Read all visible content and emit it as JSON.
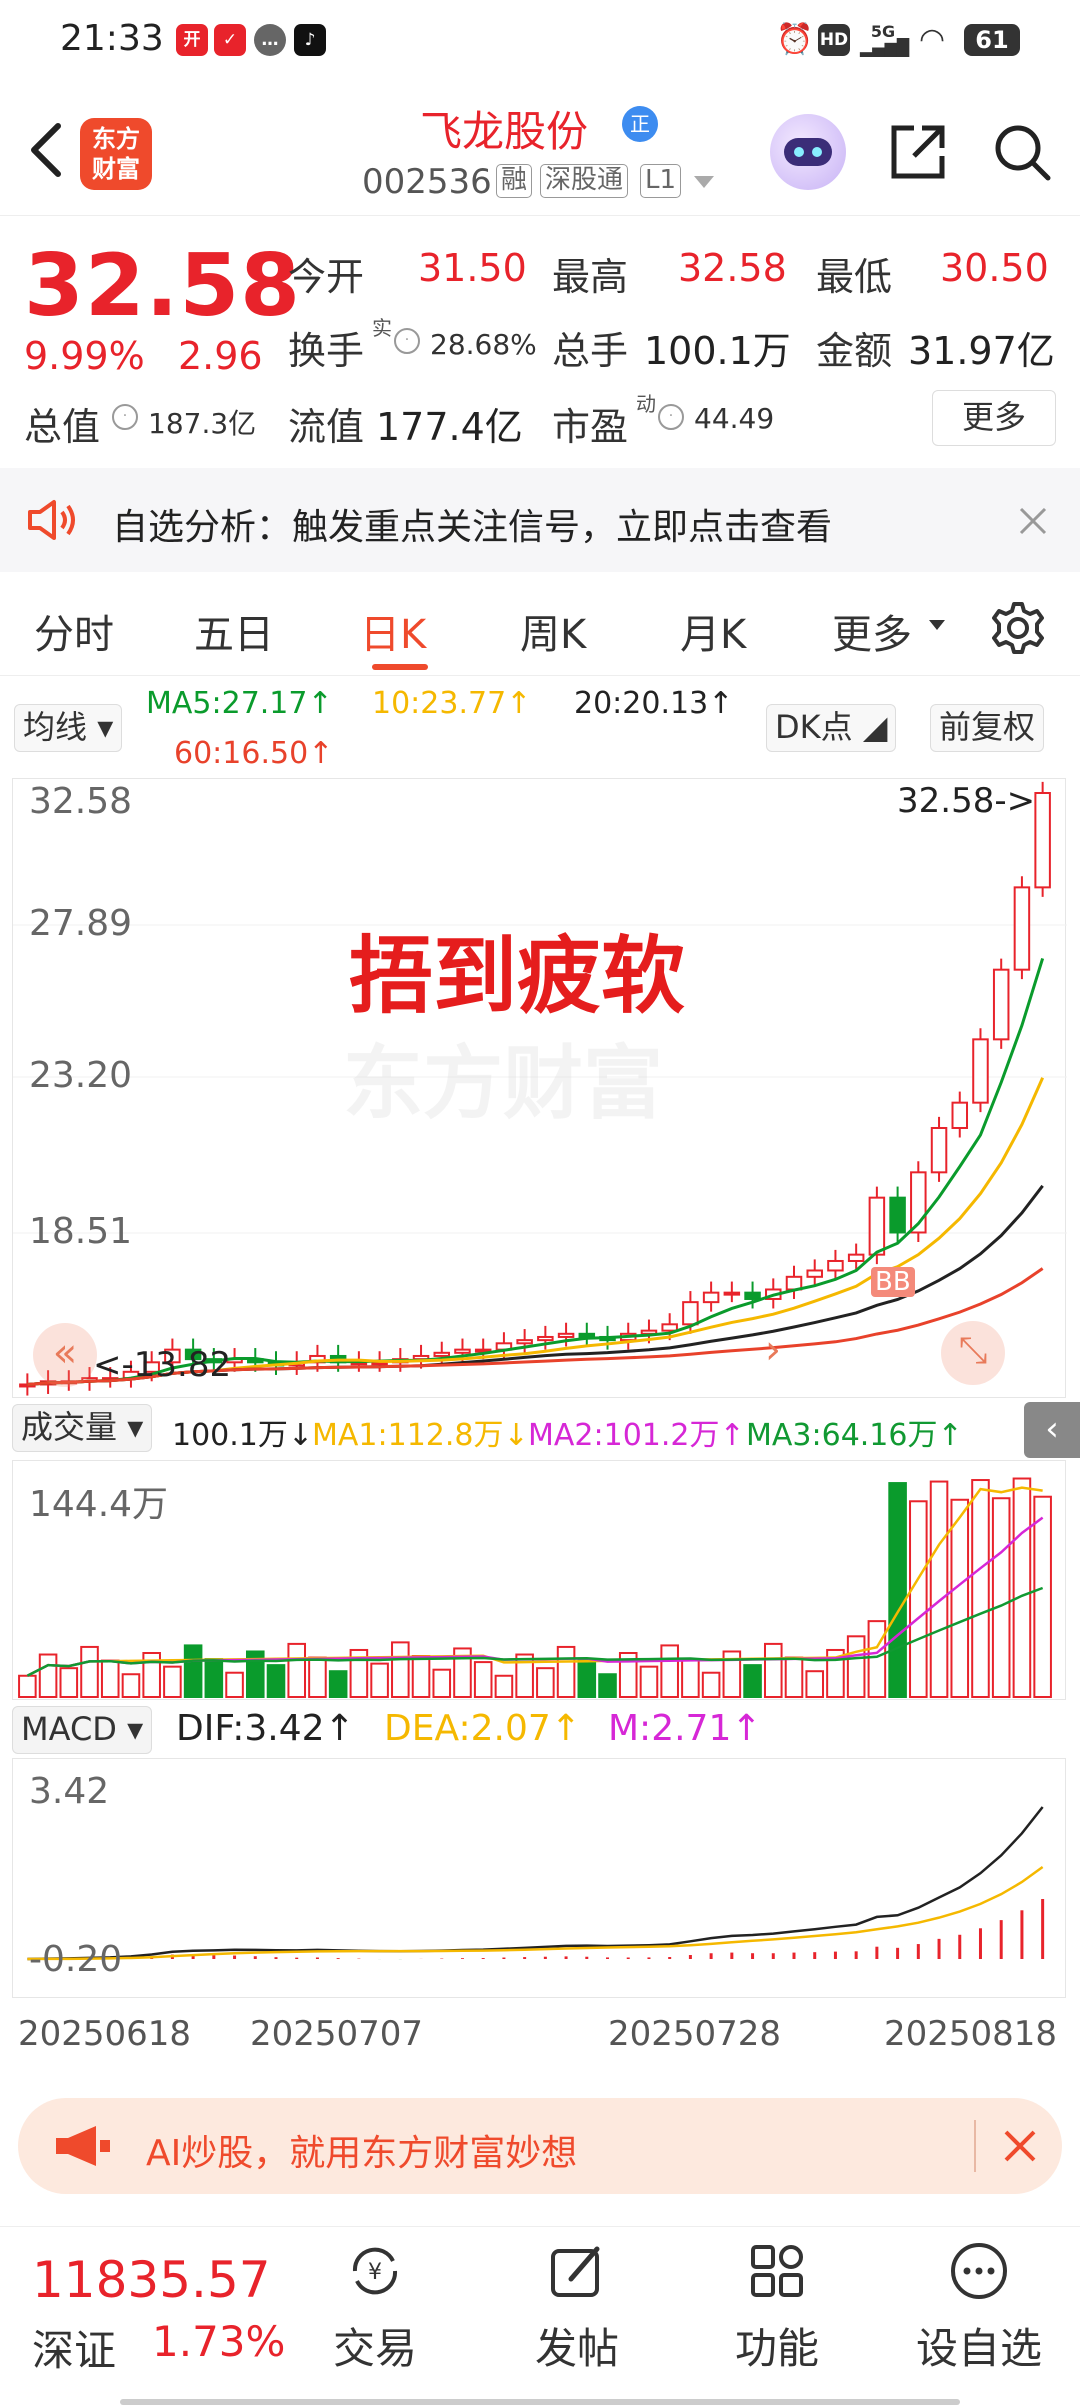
{
  "status_bar": {
    "time": "21:33",
    "battery": "61"
  },
  "header": {
    "logo_text": "东方财富",
    "stock_name": "飞龙股份",
    "badge": "正",
    "code": "002536",
    "tags": [
      "融",
      "深股通",
      "L1"
    ]
  },
  "quote": {
    "price": "32.58",
    "change_pct": "9.99%",
    "change_amt": "2.96",
    "open_label": "今开",
    "open": "31.50",
    "high_label": "最高",
    "high": "32.58",
    "low_label": "最低",
    "low": "30.50",
    "turnover_label": "换手",
    "turnover_sup": "实",
    "turnover": "28.68%",
    "volume_label": "总手",
    "volume": "100.1万",
    "amount_label": "金额",
    "amount": "31.97亿",
    "mktcap_label": "总值",
    "mktcap": "187.3亿",
    "float_label": "流值",
    "float_cap": "177.4亿",
    "pe_label": "市盈",
    "pe_sup": "动",
    "pe": "44.49",
    "more": "更多"
  },
  "notice": {
    "text": "自选分析：触发重点关注信号，立即点击查看"
  },
  "tabs": [
    "分时",
    "五日",
    "日K",
    "周K",
    "月K",
    "更多"
  ],
  "active_tab": "日K",
  "ma": {
    "selector": "均线",
    "ma5": "MA5:27.17↑",
    "ma10": "10:23.77↑",
    "ma20": "20:20.13↑",
    "ma60": "60:16.50↑",
    "dk": "DK点",
    "fq": "前复权"
  },
  "chart": {
    "y_labels": [
      "32.58",
      "27.89",
      "23.20",
      "18.51",
      "13.82"
    ],
    "max_marker": "32.58->",
    "min_marker": "<-13.82",
    "watermark": "东方财富",
    "annotation": "捂到疲软",
    "bb": "BB"
  },
  "volume": {
    "selector": "成交量",
    "current": "100.1万↓",
    "ma1": "MA1:112.8万↓",
    "ma2": "MA2:101.2万↑",
    "ma3": "MA3:64.16万↑",
    "y_max": "144.4万"
  },
  "macd": {
    "selector": "MACD",
    "dif": "DIF:3.42↑",
    "dea": "DEA:2.07↑",
    "m": "M:2.71↑",
    "y_max": "3.42",
    "y_min": "-0.20"
  },
  "dates": [
    "20250618",
    "20250707",
    "20250728",
    "20250818"
  ],
  "ai_banner": {
    "text": "AI炒股，就用东方财富妙想"
  },
  "bottom": {
    "index_value": "11835.57",
    "index_name": "深证",
    "index_change": "1.73%",
    "nav": [
      "交易",
      "发帖",
      "功能",
      "设自选"
    ]
  },
  "chart_data": {
    "type": "candlestick",
    "title": "",
    "dates": [
      "20250618",
      "20250707",
      "20250728",
      "20250818"
    ],
    "ylim": [
      13.82,
      32.58
    ],
    "closes_estimated": [
      13.9,
      14.0,
      14.0,
      14.1,
      14.1,
      14.3,
      14.6,
      15.0,
      14.7,
      14.6,
      14.7,
      14.6,
      14.5,
      14.6,
      14.8,
      14.6,
      14.6,
      14.6,
      14.7,
      14.8,
      14.9,
      15.0,
      15.0,
      15.2,
      15.3,
      15.4,
      15.5,
      15.4,
      15.3,
      15.5,
      15.6,
      15.8,
      16.5,
      16.8,
      16.8,
      16.6,
      16.9,
      17.3,
      17.5,
      17.8,
      18.0,
      19.8,
      18.7,
      20.6,
      22.0,
      22.8,
      24.8,
      27.0,
      29.6,
      32.58
    ],
    "ma_labels": [
      "MA5:27.17",
      "10:23.77",
      "20:20.13",
      "60:16.50"
    ],
    "colors": {
      "up": "#e8232b",
      "down": "#0a9b2c",
      "ma5": "#0a9b2c",
      "ma10": "#f5b800",
      "ma20": "#222222",
      "ma60": "#e8422b"
    }
  }
}
